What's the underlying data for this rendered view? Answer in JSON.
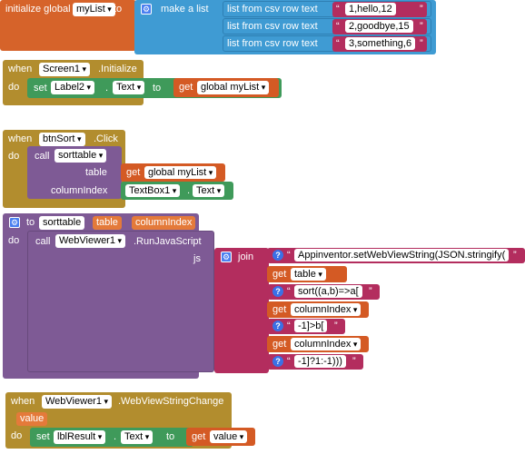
{
  "init_block": {
    "initialize_global": "initialize global",
    "var_name": "myList",
    "to": "to",
    "make_a_list": "make a list",
    "csv_label": "list from csv row  text",
    "rows": [
      "1,hello,12",
      "2,goodbye,15",
      "3,something,6"
    ]
  },
  "screen_block": {
    "when": "when",
    "component": "Screen1",
    "event": ".Initialize",
    "do": "do",
    "set": "set",
    "target": "Label2",
    "property": "Text",
    "to": "to",
    "get": "get",
    "get_value": "global myList"
  },
  "btn_block": {
    "when": "when",
    "component": "btnSort",
    "event": ".Click",
    "do": "do",
    "call": "call",
    "procedure": "sorttable",
    "arg_table": "table",
    "arg_table_get": "get",
    "arg_table_value": "global myList",
    "arg_col": "columnIndex",
    "arg_col_component": "TextBox1",
    "arg_col_property": "Text"
  },
  "proc_block": {
    "to": "to",
    "name": "sorttable",
    "param1": "table",
    "param2": "columnIndex",
    "do": "do",
    "call": "call",
    "component": "WebViewer1",
    "method": ".RunJavaScript",
    "js": "js",
    "join": "join",
    "pieces": [
      {
        "kind": "text",
        "value": "Appinventor.setWebViewString(JSON.stringify("
      },
      {
        "kind": "get",
        "value": "table"
      },
      {
        "kind": "text",
        "value": "sort((a,b)=>a["
      },
      {
        "kind": "get",
        "value": "columnIndex"
      },
      {
        "kind": "text",
        "value": "-1]>b["
      },
      {
        "kind": "get",
        "value": "columnIndex"
      },
      {
        "kind": "text",
        "value": "-1]?1:-1)))"
      }
    ],
    "get_label": "get"
  },
  "wv_block": {
    "when": "when",
    "component": "WebViewer1",
    "event": ".WebViewStringChange",
    "param": "value",
    "do": "do",
    "set": "set",
    "target": "lblResult",
    "property": "Text",
    "to": "to",
    "get": "get",
    "get_value": "value"
  },
  "colors": {
    "variable": "#d6632a",
    "list": "#3f9bd3",
    "text": "#b32d5e",
    "control": "#b28d2e",
    "component": "#3f9a5a",
    "procedure": "#7e5a95"
  }
}
